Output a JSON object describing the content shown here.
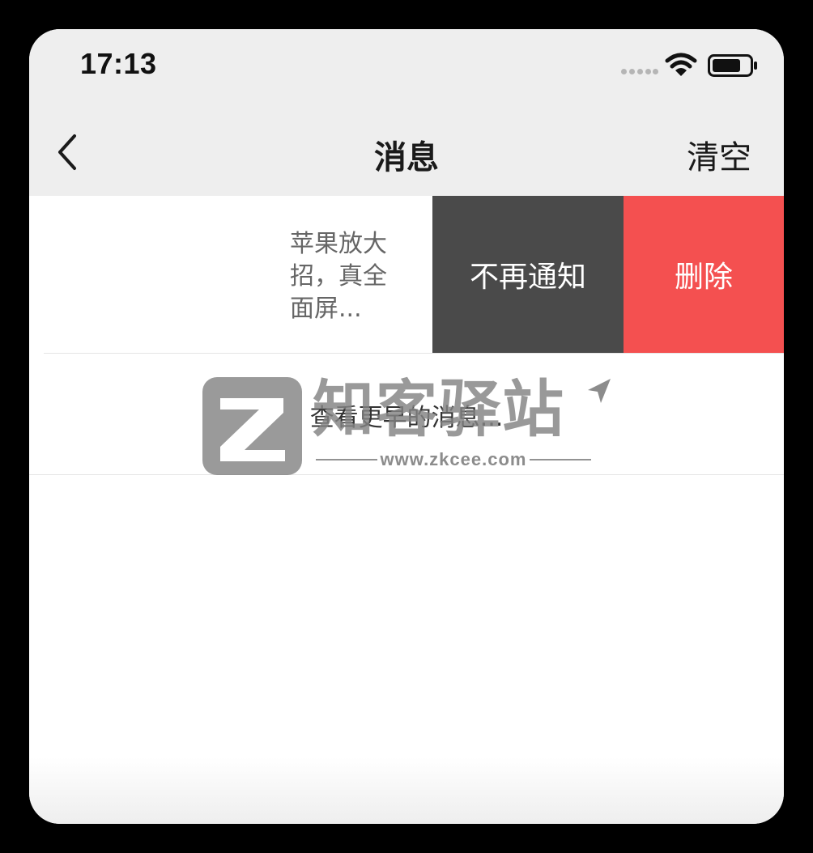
{
  "status_bar": {
    "time": "17:13",
    "signal_icon": "signal-dots-icon",
    "wifi_icon": "wifi-icon",
    "battery_icon": "battery-icon"
  },
  "nav": {
    "back_icon": "chevron-left-icon",
    "title": "消息",
    "clear_label": "清空"
  },
  "message": {
    "preview": "苹果放大\n招，真全\n面屏...",
    "actions": {
      "mute_label": "不再通知",
      "delete_label": "删除"
    }
  },
  "more": {
    "label": "查看更早的消息..."
  },
  "watermark": {
    "brand": "知客驿站",
    "url": "www.zkcee.com"
  },
  "colors": {
    "bar_bg": "#eeeeee",
    "mute_bg": "#4a4a4a",
    "delete_bg": "#f45050"
  }
}
